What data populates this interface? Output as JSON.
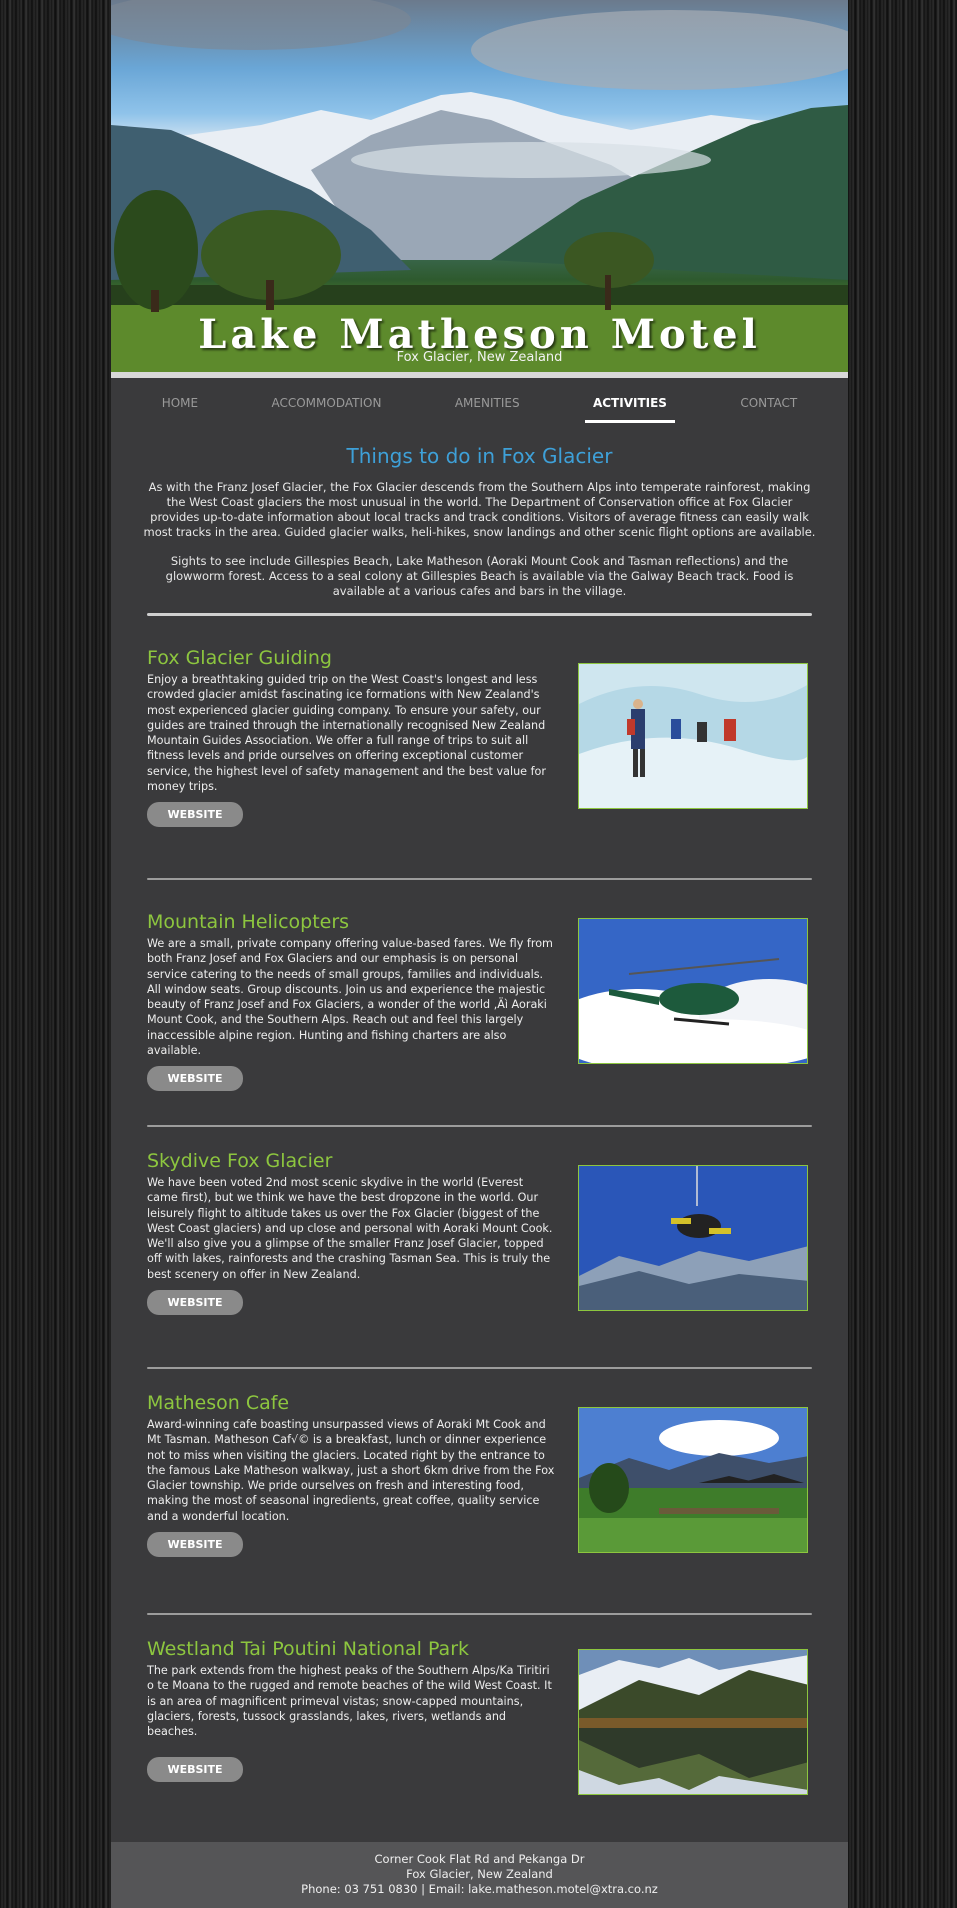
{
  "header": {
    "title": "Lake Matheson Motel",
    "subtitle": "Fox Glacier, New Zealand"
  },
  "nav": {
    "items": [
      "HOME",
      "ACCOMMODATION",
      "AMENITIES",
      "ACTIVITIES",
      "CONTACT"
    ],
    "active": "ACTIVITIES"
  },
  "intro": {
    "title": "Things to do in Fox Glacier",
    "p1": "As with the Franz Josef Glacier, the Fox Glacier descends from the Southern Alps into temperate rainforest, making the West Coast glaciers the most unusual in the world. The Department of Conservation office at Fox Glacier provides up-to-date information about local tracks and track conditions. Visitors of average fitness can easily walk most tracks in the area. Guided glacier walks, heli-hikes, snow landings and other scenic flight options are available.",
    "p2": "Sights to see include Gillespies Beach, Lake Matheson (Aoraki Mount Cook and Tasman reflections) and the glowworm forest. Access to a seal colony at Gillespies Beach is available via the Galway Beach track. Food is available at a various cafes and bars in the village."
  },
  "activities": [
    {
      "title": "Fox Glacier Guiding",
      "text": "Enjoy a breathtaking guided trip on the West Coast's longest and less crowded glacier amidst fascinating ice formations with New Zealand's most experienced glacier guiding company. To ensure your safety, our guides are trained through the internationally recognised New Zealand Mountain Guides Association. We offer a full range of trips to suit all fitness levels and pride ourselves on offering exceptional customer service, the highest level of safety management and the best value for money trips.",
      "button": "WEBSITE"
    },
    {
      "title": "Mountain Helicopters",
      "text": "We are a small, private company offering value-based fares. We fly from both Franz Josef and Fox Glaciers and our emphasis is on personal service catering to the needs of small groups, families and individuals. All window seats. Group discounts. Join us and experience the majestic beauty of Franz Josef and Fox Glaciers, a wonder of the world ‚Äì Aoraki Mount Cook, and the Southern Alps. Reach out and feel this largely inaccessible alpine region. Hunting and fishing charters are also available.",
      "button": "WEBSITE"
    },
    {
      "title": "Skydive Fox Glacier",
      "text": "We have been voted 2nd most scenic skydive in the world (Everest came first), but we think we have the best dropzone in the world. Our leisurely flight to altitude takes us over the Fox Glacier (biggest of the West Coast glaciers) and up close and personal with Aoraki Mount Cook. We'll also give you a glimpse of the smaller Franz Josef Glacier, topped off with lakes, rainforests and the crashing Tasman Sea. This is truly the best scenery on offer in New Zealand.",
      "button": "WEBSITE"
    },
    {
      "title": "Matheson Cafe",
      "text": "Award-winning cafe boasting unsurpassed views of Aoraki Mt Cook and Mt Tasman. Matheson Caf√© is a breakfast, lunch or dinner experience not to miss when visiting the glaciers. Located right by the entrance to the famous Lake Matheson walkway, just a short 6km drive from the Fox Glacier township. We pride ourselves on fresh and interesting food, making the most of seasonal ingredients, great coffee, quality service and a wonderful location.",
      "button": "WEBSITE"
    },
    {
      "title": "Westland Tai Poutini National Park",
      "text": "The park extends from the highest peaks of the Southern Alps/Ka Tiritiri o te Moana to the rugged and remote beaches of the wild West Coast. It is an area of magnificent primeval vistas; snow-capped mountains, glaciers, forests, tussock grasslands, lakes, rivers, wetlands and beaches.",
      "button": "WEBSITE"
    }
  ],
  "footer": {
    "address1": "Corner Cook Flat Rd and Pekanga Dr",
    "address2": "Fox Glacier, New Zealand",
    "contact": "Phone:  03 751 0830  |  Email: lake.matheson.motel@xtra.co.nz"
  }
}
